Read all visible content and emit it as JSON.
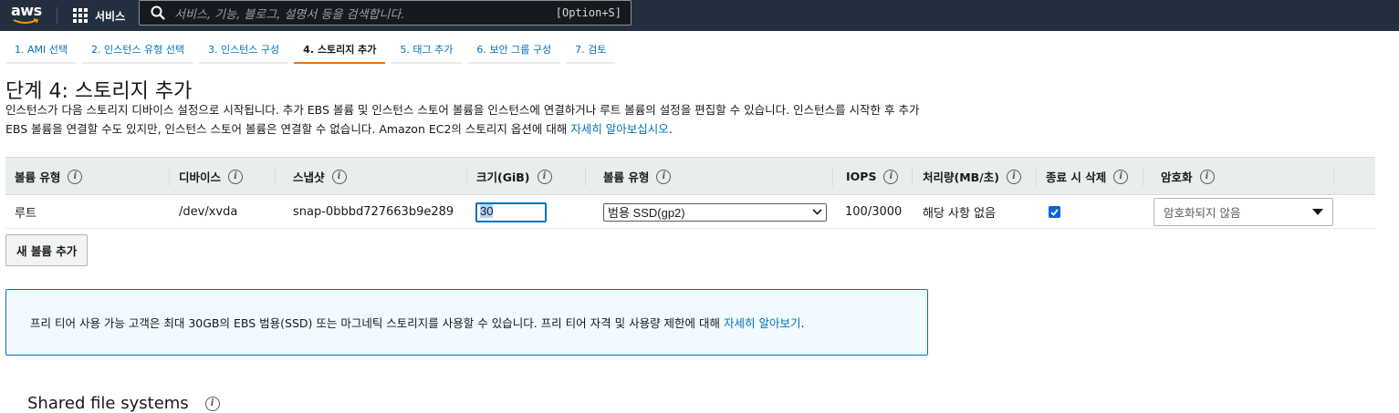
{
  "nav": {
    "logo": "aws",
    "services_label": "서비스",
    "search_placeholder": "서비스, 기능, 블로그, 설명서 등을 검색합니다.",
    "search_shortcut": "[Option+S]"
  },
  "steps": [
    {
      "label": "1. AMI 선택",
      "active": false
    },
    {
      "label": "2. 인스턴스 유형 선택",
      "active": false
    },
    {
      "label": "3. 인스턴스 구성",
      "active": false
    },
    {
      "label": "4. 스토리지 추가",
      "active": true
    },
    {
      "label": "5. 태그 추가",
      "active": false
    },
    {
      "label": "6. 보안 그룹 구성",
      "active": false
    },
    {
      "label": "7. 검토",
      "active": false
    }
  ],
  "page": {
    "title": "단계 4: 스토리지 추가",
    "description": "인스턴스가 다음 스토리지 디바이스 설정으로 시작됩니다. 추가 EBS 볼륨 및 인스턴스 스토어 볼륨을 인스턴스에 연결하거나 루트 볼륨의 설정을 편집할 수 있습니다. 인스턴스를 시작한 후 추가 EBS 볼륨을 연결할 수도 있지만, 인스턴스 스토어 볼륨은 연결할 수 없습니다. Amazon EC2의 스토리지 옵션에 대해",
    "learn_more": "자세히 알아보십시오",
    "period": "."
  },
  "table": {
    "headers": [
      "볼륨 유형",
      "디바이스",
      "스냅샷",
      "크기(GiB)",
      "볼륨 유형",
      "IOPS",
      "처리량(MB/초)",
      "종료 시 삭제",
      "암호화"
    ],
    "row": {
      "volume_kind": "루트",
      "device": "/dev/xvda",
      "snapshot": "snap-0bbbd727663b9e289",
      "size": "30",
      "volume_type": "범용 SSD(gp2)",
      "iops": "100/3000",
      "throughput": "해당 사항 없음",
      "delete_on_termination": true,
      "encryption": "암호화되지 않음"
    }
  },
  "add_volume_button": "새 볼륨 추가",
  "alert": {
    "text": "프리 티어 사용 가능 고객은 최대 30GB의 EBS 범용(SSD) 또는 마그네틱 스토리지를 사용할 수 있습니다. 프리 티어 자격 및 사용량 제한에 대해",
    "link": "자세히 알아보기",
    "period": "."
  },
  "next_section": {
    "title": "Shared file systems"
  },
  "colors": {
    "nav_bg": "#232f3e",
    "accent": "#ec7211",
    "link": "#0073bb",
    "alert_bg": "#f1faff"
  }
}
